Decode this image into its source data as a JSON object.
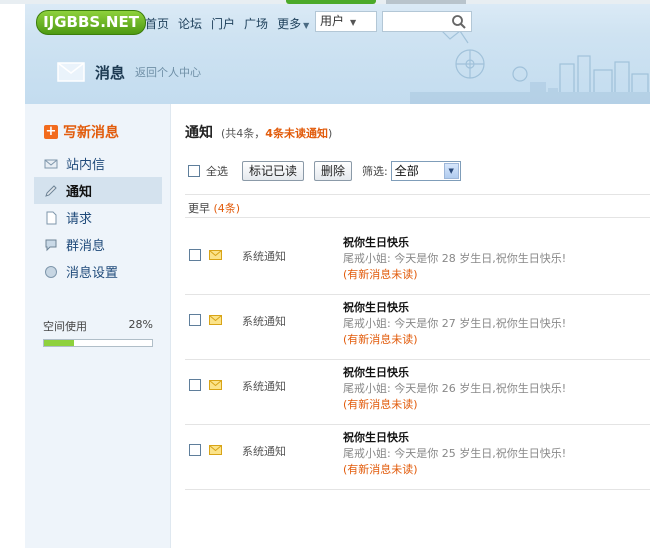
{
  "header": {
    "logo_text": "IJGBBS.NET",
    "nav": [
      "首页",
      "论坛",
      "门户",
      "广场",
      "更多"
    ],
    "user_select": "用户",
    "page_title": "消息",
    "back_link": "返回个人中心"
  },
  "sidebar": {
    "compose_label": "写新消息",
    "items": [
      {
        "label": "站内信",
        "icon": "envelope-icon",
        "active": false
      },
      {
        "label": "通知",
        "icon": "pencil-icon",
        "active": true
      },
      {
        "label": "请求",
        "icon": "document-icon",
        "active": false
      },
      {
        "label": "群消息",
        "icon": "chat-icon",
        "active": false
      },
      {
        "label": "消息设置",
        "icon": "settings-circle-icon",
        "active": false
      }
    ],
    "usage_label": "空间使用",
    "usage_percent_text": "28%",
    "usage_fraction": 0.28
  },
  "main": {
    "title": "通知",
    "count_prefix": "(共4条，",
    "unread_text": "4条未读通知",
    "count_suffix": ")",
    "select_all_label": "全选",
    "mark_read_button": "标记已读",
    "delete_button": "删除",
    "filter_label": "筛选:",
    "filter_value": "全部",
    "group_label": "更早",
    "group_count": "(4条)",
    "notifications": [
      {
        "type": "系统通知",
        "subject": "祝你生日快乐",
        "body": "尾戒小姐: 今天是你 28 岁生日,祝你生日快乐!",
        "flag": "(有新消息未读)"
      },
      {
        "type": "系统通知",
        "subject": "祝你生日快乐",
        "body": "尾戒小姐: 今天是你 27 岁生日,祝你生日快乐!",
        "flag": "(有新消息未读)"
      },
      {
        "type": "系统通知",
        "subject": "祝你生日快乐",
        "body": "尾戒小姐: 今天是你 26 岁生日,祝你生日快乐!",
        "flag": "(有新消息未读)"
      },
      {
        "type": "系统通知",
        "subject": "祝你生日快乐",
        "body": "尾戒小姐: 今天是你 25 岁生日,祝你生日快乐!",
        "flag": "(有新消息未读)"
      }
    ]
  },
  "colors": {
    "accent_orange": "#e25c0c",
    "logo_green": "#6bb526",
    "sidebar_bg": "#eef4fa",
    "header_bg": "#cfe3f2"
  }
}
